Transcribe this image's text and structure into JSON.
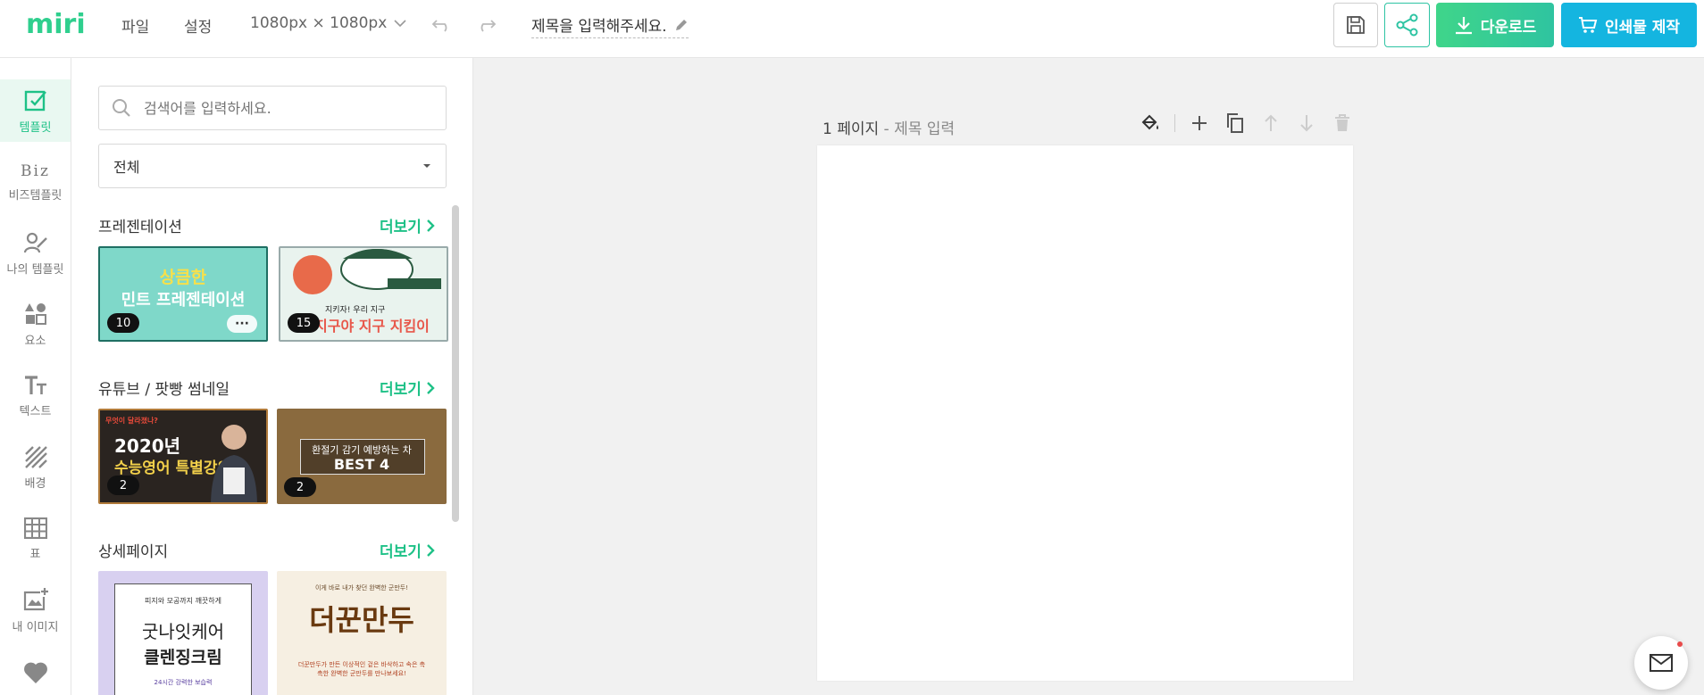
{
  "brand": {
    "logo_text": "miri",
    "accent": "#1ec187"
  },
  "menu": {
    "file": "파일",
    "settings": "설정"
  },
  "size_select": {
    "value": "1080px × 1080px"
  },
  "doc_title": "제목을 입력해주세요.",
  "buttons": {
    "download": "다운로드",
    "print": "인쇄물 제작"
  },
  "nav": [
    {
      "label": "템플릿",
      "icon": "template-icon",
      "active": true
    },
    {
      "label": "비즈템플릿",
      "icon": "biz-icon",
      "icon_text": "Biz"
    },
    {
      "label": "나의 템플릿",
      "icon": "my-template-icon"
    },
    {
      "label": "요소",
      "icon": "elements-icon"
    },
    {
      "label": "텍스트",
      "icon": "text-icon"
    },
    {
      "label": "배경",
      "icon": "background-icon"
    },
    {
      "label": "표",
      "icon": "table-icon"
    },
    {
      "label": "내 이미지",
      "icon": "my-image-icon"
    },
    {
      "label": "",
      "icon": "heart-icon"
    }
  ],
  "panel": {
    "search_placeholder": "검색어를 입력하세요.",
    "category": "전체",
    "more_label": "더보기",
    "sections": [
      {
        "title": "프레젠테이션",
        "items": [
          {
            "count": "10",
            "line1": "상큼한",
            "line2": "민트 프레젠테이션"
          },
          {
            "count": "15",
            "line1": "지키자! 우리 지구",
            "line2": "지구야 지구 지킴이"
          }
        ]
      },
      {
        "title": "유튜브 / 팟빵 썸네일",
        "items": [
          {
            "count": "2",
            "tag": "무엇이 달라졌나?",
            "line1": "2020년",
            "line2": "수능영어 특별강의"
          },
          {
            "count": "2",
            "line1": "환절기 감기 예방하는 차",
            "line2": "BEST 4"
          }
        ]
      },
      {
        "title": "상세페이지",
        "items": [
          {
            "sub": "피지와 모공까지 깨끗하게",
            "line1": "굿나잇케어",
            "line2": "클렌징크림",
            "foot": "24시간 강력한 보습력"
          },
          {
            "sub": "이게 바로 내가 찾던 완벽한 군만두!",
            "line1": "더꾼만두",
            "line2": "더꾼만두가 만든 이상적인 겉은 바삭하고 속은 촉촉한 완벽한 군만두를 만나보세요!"
          }
        ]
      }
    ]
  },
  "page": {
    "number_label": "1 페이지",
    "title_placeholder": "- 제목 입력"
  }
}
